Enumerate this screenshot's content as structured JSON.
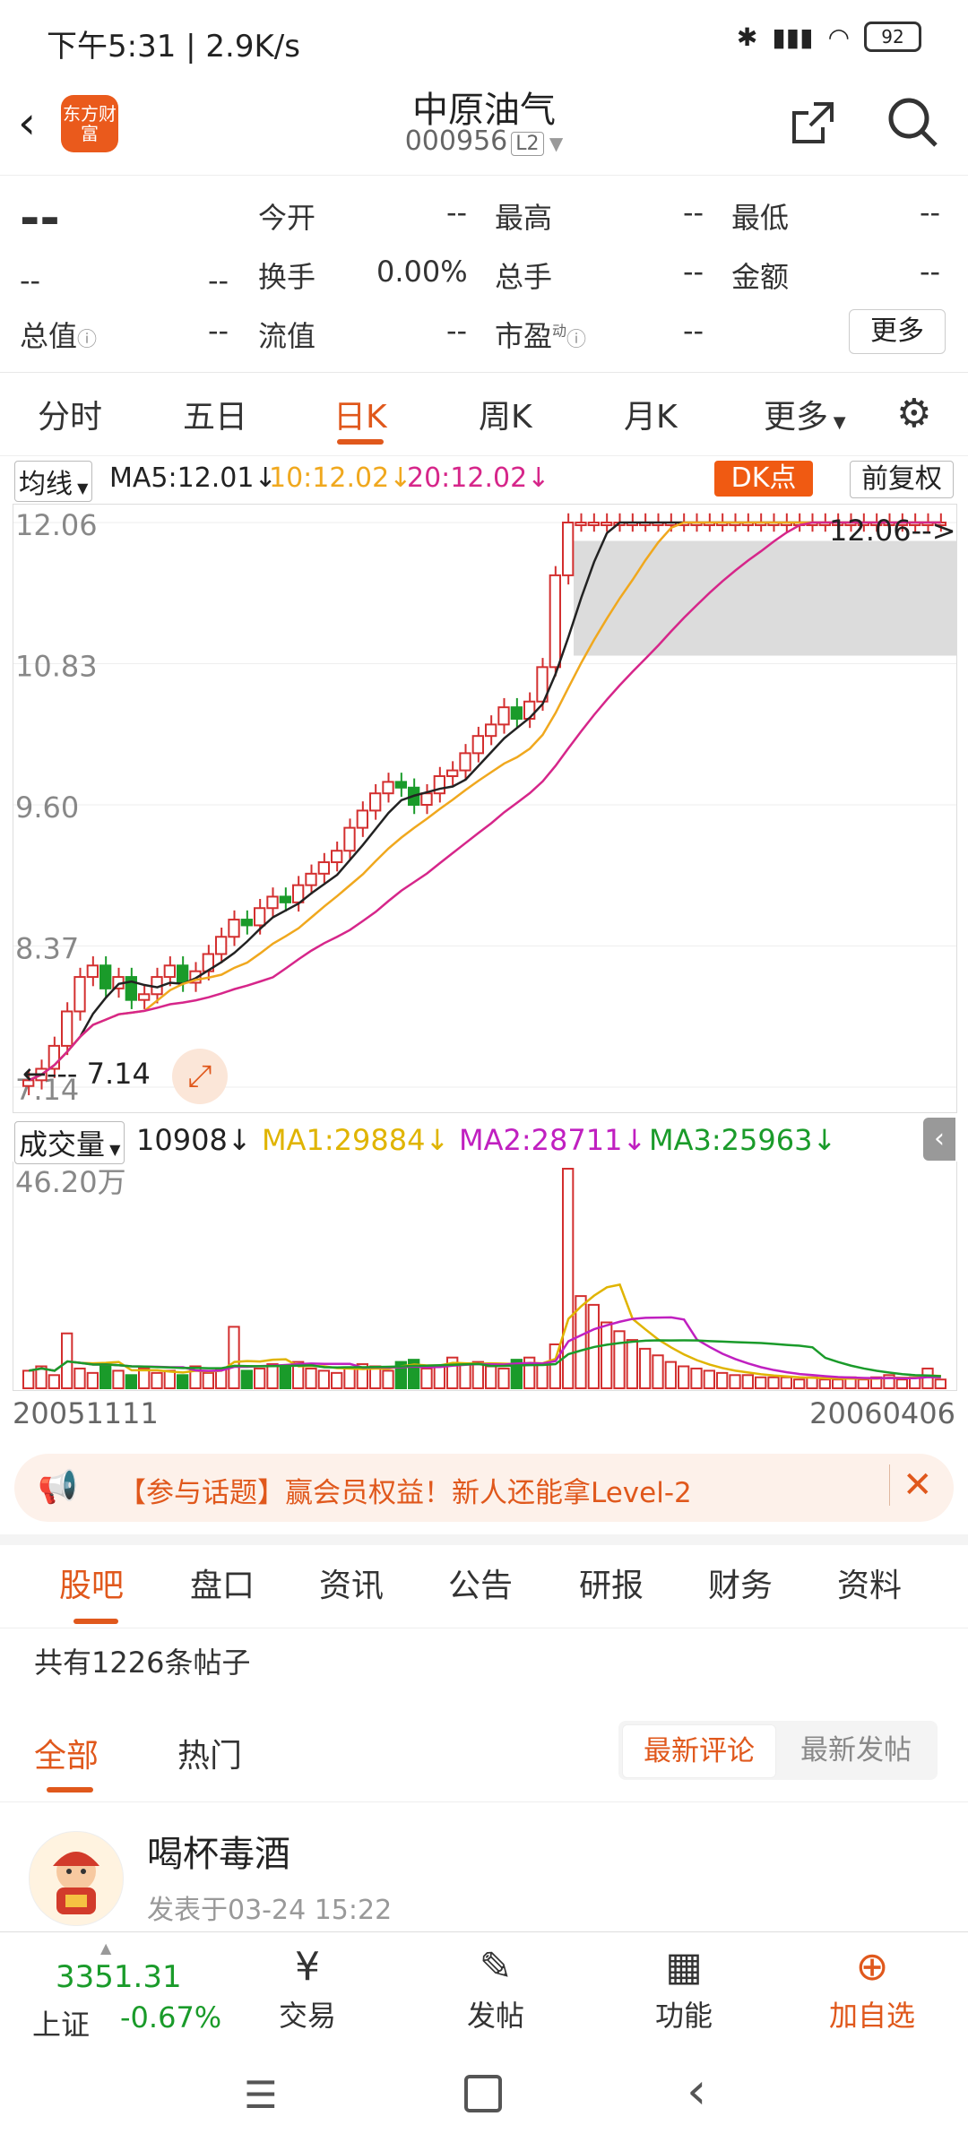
{
  "status": {
    "time_text": "下午5:31 | 2.9K/s",
    "battery": "92"
  },
  "header": {
    "logo_text": "东方财富",
    "title": "中原油气",
    "code": "000956",
    "level": "L2"
  },
  "quote": {
    "price": "--",
    "change": "--",
    "change_pct": "--",
    "open_label": "今开",
    "open": "--",
    "high_label": "最高",
    "high": "--",
    "low_label": "最低",
    "low": "--",
    "turnover_label": "换手",
    "turnover": "0.00%",
    "volume_label": "总手",
    "volume": "--",
    "amount_label": "金额",
    "amount": "--",
    "mktcap_label": "总值",
    "mktcap": "--",
    "float_label": "流值",
    "float": "--",
    "pe_label": "市盈",
    "pe_sup": "动",
    "pe": "--",
    "more_label": "更多"
  },
  "ktabs": [
    "分时",
    "五日",
    "日K",
    "周K",
    "月K",
    "更多"
  ],
  "ma": {
    "selector": "均线",
    "ma5": "MA5:12.01",
    "ma10": "10:12.02",
    "ma20": "20:12.02",
    "dk_label": "DK点",
    "adj_label": "前复权"
  },
  "vol": {
    "selector": "成交量",
    "value": "10908",
    "ma1": "MA1:29884",
    "ma2": "MA2:28711",
    "ma3": "MA3:25963"
  },
  "chart_data": {
    "type": "candlestick",
    "y_ticks": [
      "12.06",
      "10.83",
      "9.60",
      "8.37",
      "7.14"
    ],
    "ylim": [
      7.14,
      12.06
    ],
    "annotations": [
      "7.14",
      "12.06"
    ],
    "close_path": [
      7.2,
      7.3,
      7.5,
      7.8,
      8.1,
      8.2,
      8.0,
      8.1,
      7.9,
      7.95,
      8.1,
      8.2,
      8.05,
      8.15,
      8.3,
      8.45,
      8.6,
      8.55,
      8.7,
      8.8,
      8.75,
      8.9,
      9.0,
      9.1,
      9.2,
      9.4,
      9.55,
      9.7,
      9.8,
      9.75,
      9.6,
      9.7,
      9.85,
      9.9,
      10.05,
      10.2,
      10.3,
      10.45,
      10.35,
      10.5,
      10.8,
      11.6,
      12.06,
      12.06,
      12.06,
      12.06,
      12.06,
      12.06,
      12.06,
      12.06,
      12.06,
      12.06,
      12.06,
      12.06,
      12.06,
      12.06,
      12.06,
      12.06,
      12.06,
      12.06,
      12.06,
      12.06,
      12.06,
      12.06,
      12.06,
      12.06,
      12.06,
      12.06,
      12.06,
      12.06,
      12.06,
      12.06
    ],
    "vol_max_label": "46.20万",
    "volumes": [
      8,
      10,
      6,
      25,
      9,
      7,
      11,
      8,
      6,
      9,
      7,
      8,
      6,
      10,
      7,
      9,
      28,
      8,
      9,
      11,
      10,
      12,
      9,
      8,
      7,
      9,
      11,
      10,
      8,
      12,
      13,
      9,
      10,
      14,
      11,
      12,
      10,
      9,
      13,
      14,
      11,
      20,
      100,
      42,
      38,
      30,
      26,
      22,
      18,
      15,
      12,
      10,
      9,
      8,
      7,
      6,
      6,
      5,
      5,
      5,
      4,
      5,
      4,
      4,
      5,
      4,
      5,
      6,
      4,
      5,
      9,
      4
    ],
    "dates": [
      "20051111",
      "20060406"
    ]
  },
  "promo": {
    "text": "【参与话题】赢会员权益！新人还能拿Level-2"
  },
  "sections": [
    "股吧",
    "盘口",
    "资讯",
    "公告",
    "研报",
    "财务",
    "资料"
  ],
  "posts": {
    "count_text": "共有1226条帖子",
    "filters": [
      "全部",
      "热门"
    ],
    "sorts": [
      "最新评论",
      "最新发帖"
    ],
    "first_author": "喝杯毒酒",
    "first_time": "发表于03-24 15:22"
  },
  "bottom": {
    "index_value": "3351.31",
    "index_name": "上证",
    "index_change": "-0.67%",
    "trade": "交易",
    "post": "发帖",
    "func": "功能",
    "add": "加自选"
  },
  "colors": {
    "accent": "#e0581c",
    "up": "#d32f2f",
    "down": "#1a9b2a",
    "ma5": "#222222",
    "ma10": "#f0a81e",
    "ma20": "#d6268a"
  }
}
